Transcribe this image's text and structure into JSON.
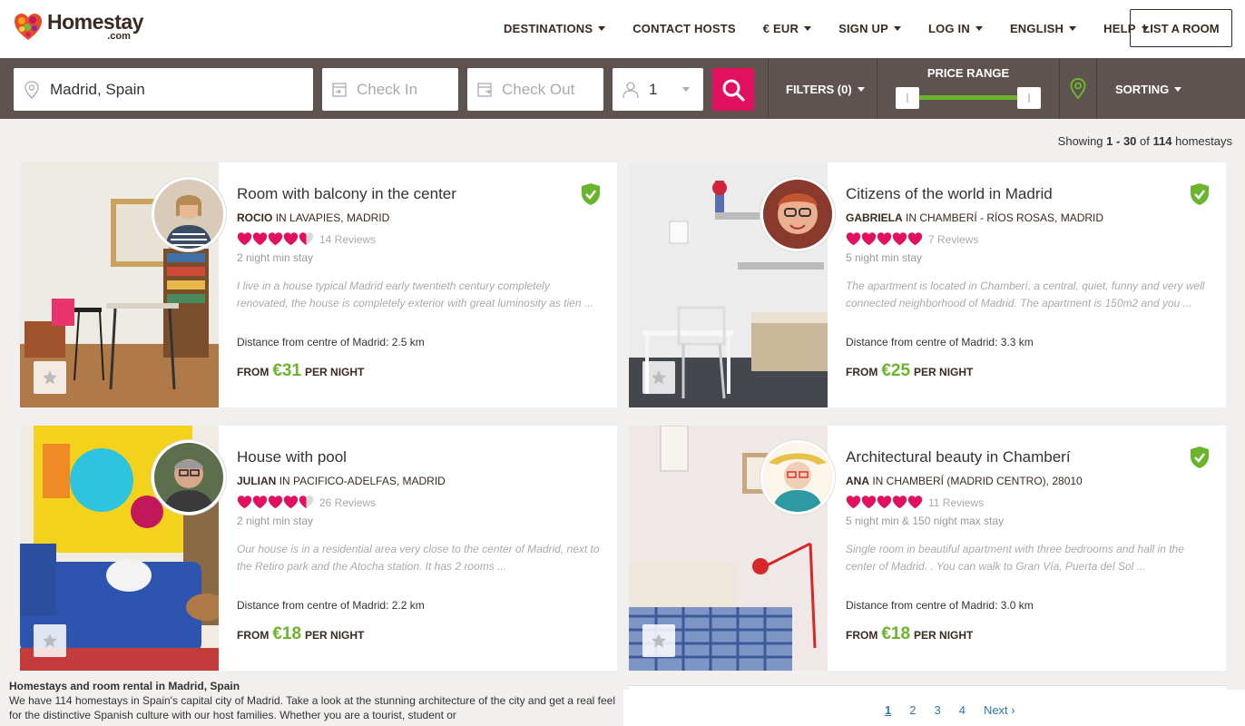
{
  "brand": {
    "name": "Homestay",
    "domain": ".com"
  },
  "nav": [
    {
      "label": "DESTINATIONS",
      "dropdown": true
    },
    {
      "label": "CONTACT HOSTS",
      "dropdown": false
    },
    {
      "label": "€ EUR",
      "dropdown": true
    },
    {
      "label": "SIGN UP",
      "dropdown": true
    },
    {
      "label": "LOG IN",
      "dropdown": true
    },
    {
      "label": "ENGLISH",
      "dropdown": true
    },
    {
      "label": "HELP",
      "dropdown": true
    }
  ],
  "list_room_label": "LIST A ROOM",
  "search": {
    "location_value": "Madrid, Spain",
    "check_in_placeholder": "Check In",
    "check_out_placeholder": "Check Out",
    "guests_value": "1",
    "filters_label": "FILTERS (0)",
    "price_range_label": "PRICE RANGE",
    "price_range_low_fraction": 0,
    "price_range_high_fraction": 1,
    "sorting_label": "SORTING"
  },
  "results": {
    "prefix": "Showing",
    "range": "1 - 30",
    "of": "of",
    "total": "114",
    "suffix": "homestays"
  },
  "listings": [
    {
      "title": "Room with balcony in the center",
      "host": "ROCIO",
      "location": "IN LAVAPIES, MADRID",
      "rating": 4.5,
      "reviews": "14 Reviews",
      "stay": "2 night min stay",
      "description": "I live in a house typical Madrid early twentieth century completely renovated, the house is completely exterior with great luminosity as tien ...",
      "distance": "Distance from centre of Madrid: 2.5 km",
      "from": "FROM",
      "price": "€31",
      "per_night": "PER NIGHT",
      "verified": true
    },
    {
      "title": "Citizens of the world in Madrid",
      "host": "GABRIELA",
      "location": "IN CHAMBERÍ - RÍOS ROSAS, MADRID",
      "rating": 5,
      "reviews": "7 Reviews",
      "stay": "5 night min stay",
      "description": "The apartment is located in Chamberí, a central, quiet, funny and very well connected neighborhood of Madrid. The apartment is 150m2 and you ...",
      "distance": "Distance from centre of Madrid: 3.3 km",
      "from": "FROM",
      "price": "€25",
      "per_night": "PER NIGHT",
      "verified": true
    },
    {
      "title": "House with pool",
      "host": "JULIAN",
      "location": "IN PACIFICO-ADELFAS, MADRID",
      "rating": 4.5,
      "reviews": "26 Reviews",
      "stay": "2 night min stay",
      "description": "Our house is in a residential area very close to the center of Madrid, next to the Retiro park and the Atocha station. It has 2 rooms ...",
      "distance": "Distance from centre of Madrid: 2.2 km",
      "from": "FROM",
      "price": "€18",
      "per_night": "PER NIGHT",
      "verified": false
    },
    {
      "title": "Architectural beauty in Chamberí",
      "host": "ANA",
      "location": "IN CHAMBERÍ (MADRID CENTRO), 28010",
      "rating": 5,
      "reviews": "11 Reviews",
      "stay": "5 night min & 150 night max stay",
      "description": "Single room in beautiful apartment with three bedrooms and hall in the center of Madrid. . You can walk to Gran Vía, Puerta del Sol ...",
      "distance": "Distance from centre of Madrid: 3.0 km",
      "from": "FROM",
      "price": "€18",
      "per_night": "PER NIGHT",
      "verified": true
    }
  ],
  "seo": {
    "title": "Homestays and room rental in Madrid, Spain",
    "body": "We have 114 homestays in Spain's capital city of Madrid. Take a look at the stunning architecture of the city and get a real feel for the distinctive Spanish culture with our host families. Whether you are a tourist, student or"
  },
  "pagination": {
    "pages": [
      "1",
      "2",
      "3",
      "4"
    ],
    "current": "1",
    "next": "Next ›"
  },
  "colors": {
    "accent": "#e3105f",
    "green": "#6bb52c",
    "brown": "#3b2a22",
    "bar": "#5e534f"
  }
}
